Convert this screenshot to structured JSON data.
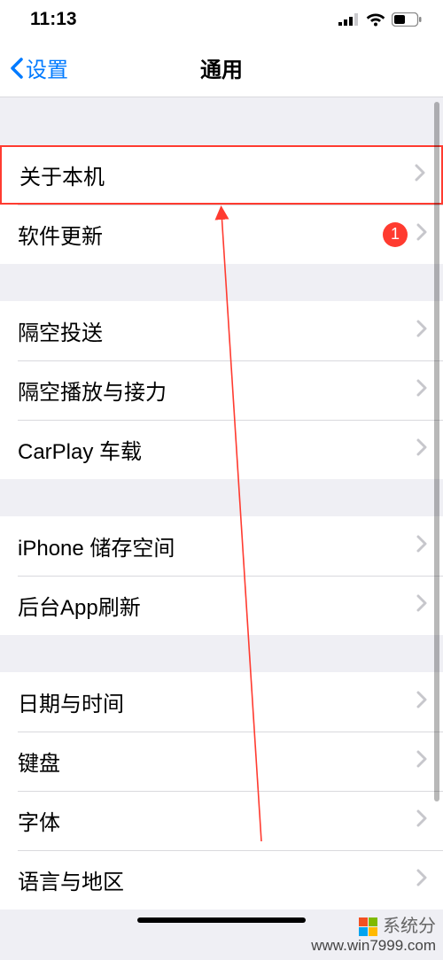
{
  "status": {
    "time": "11:13"
  },
  "nav": {
    "back": "设置",
    "title": "通用"
  },
  "sections": [
    {
      "spacer": 54,
      "rows": [
        {
          "key": "about",
          "label": "关于本机",
          "highlight": true
        },
        {
          "key": "software-update",
          "label": "软件更新",
          "badge": "1"
        }
      ]
    },
    {
      "spacer": 42,
      "rows": [
        {
          "key": "airdrop",
          "label": "隔空投送"
        },
        {
          "key": "airplay-handoff",
          "label": "隔空播放与接力"
        },
        {
          "key": "carplay",
          "label": "CarPlay 车载"
        }
      ]
    },
    {
      "spacer": 42,
      "rows": [
        {
          "key": "iphone-storage",
          "label": "iPhone 储存空间"
        },
        {
          "key": "background-app-refresh",
          "label": "后台App刷新"
        }
      ]
    },
    {
      "spacer": 42,
      "rows": [
        {
          "key": "date-time",
          "label": "日期与时间"
        },
        {
          "key": "keyboard",
          "label": "键盘"
        },
        {
          "key": "fonts",
          "label": "字体"
        },
        {
          "key": "language-region",
          "label": "语言与地区"
        }
      ]
    }
  ],
  "watermark": {
    "brand": "系统分",
    "url": "www.win7999.com"
  }
}
